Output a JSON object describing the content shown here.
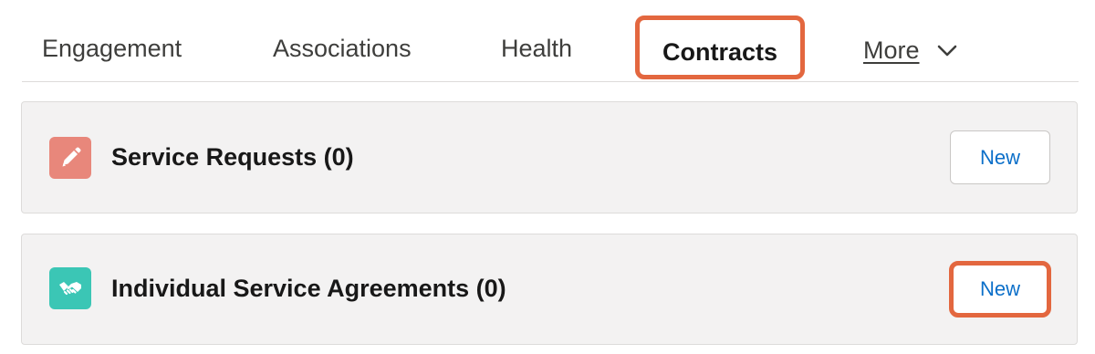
{
  "tabs": [
    {
      "label": "Engagement"
    },
    {
      "label": "Associations"
    },
    {
      "label": "Health"
    },
    {
      "label": "Contracts",
      "active": true
    },
    {
      "label": "More"
    }
  ],
  "cards": [
    {
      "title": "Service Requests (0)",
      "icon": "pencil-icon",
      "icon_color": "#e8877b",
      "button_label": "New"
    },
    {
      "title": "Individual Service Agreements (0)",
      "icon": "handshake-icon",
      "icon_color": "#3bc6b5",
      "button_label": "New"
    }
  ],
  "colors": {
    "highlight": "#e3673f",
    "link": "#0b6fc9",
    "card_background": "#f3f2f2"
  }
}
